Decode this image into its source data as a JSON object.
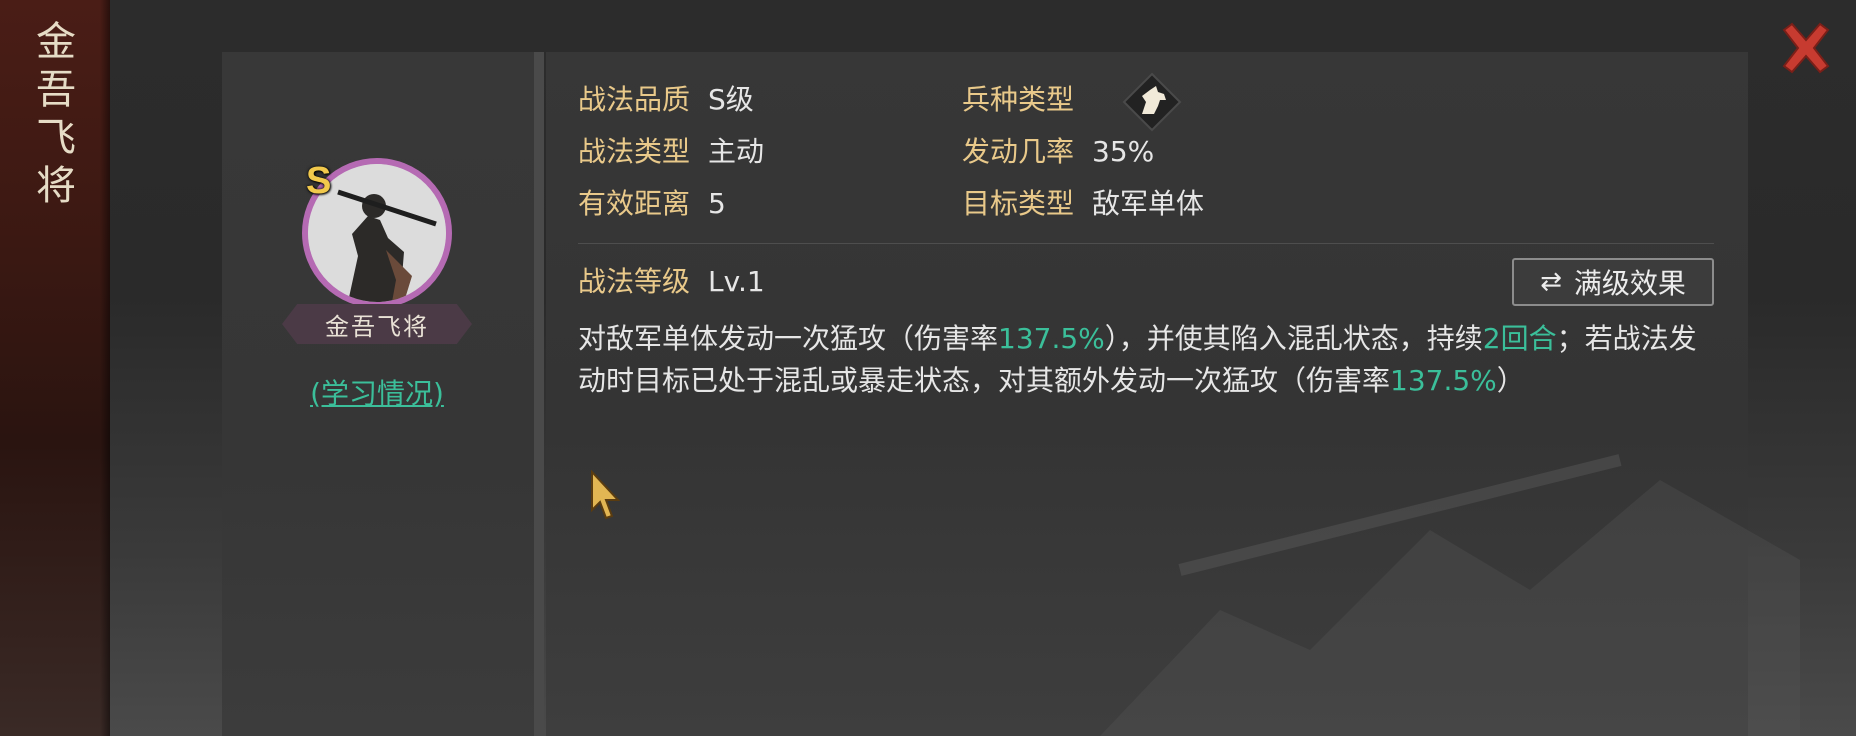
{
  "side_title": [
    "金",
    "吾",
    "飞",
    "将"
  ],
  "skill": {
    "grade_badge": "S",
    "name": "金吾飞将",
    "study_link": "(学习情况)"
  },
  "stats": {
    "quality_label": "战法品质",
    "quality_value": "S级",
    "unit_label": "兵种类型",
    "unit_icon": "horse-icon",
    "type_label": "战法类型",
    "type_value": "主动",
    "rate_label": "发动几率",
    "rate_value": "35%",
    "range_label": "有效距离",
    "range_value": "5",
    "target_label": "目标类型",
    "target_value": "敌军单体",
    "level_label": "战法等级",
    "level_value": "Lv.1"
  },
  "max_button": {
    "icon": "⇄",
    "label": "满级效果"
  },
  "description": {
    "p1": "对敌军单体发动一次猛攻（伤害率",
    "v1": "137.5%",
    "p2": "），并使其陷入混乱状态，持续",
    "v2": "2回合",
    "p3": "；若战法发动时目标已处于混乱或暴走状态，对其额外发动一次猛攻（伤害率",
    "v3": "137.5%",
    "p4": "）"
  },
  "colors": {
    "label_gold": "#e9c98a",
    "accent_green": "#3bbf9a",
    "close_red": "#c73b30",
    "avatar_ring": "#b56ab3",
    "badge_gold": "#f2c94c"
  }
}
